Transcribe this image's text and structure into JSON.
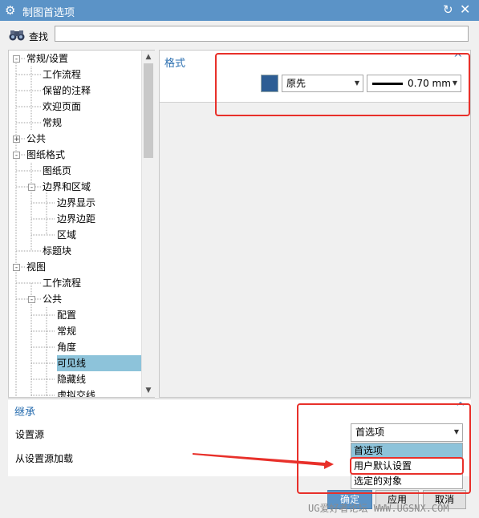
{
  "window": {
    "title": "制图首选项"
  },
  "find": {
    "label": "查找",
    "value": ""
  },
  "tree": {
    "items": [
      {
        "label": "常规/设置",
        "level": 0,
        "expander": "-"
      },
      {
        "label": "工作流程",
        "level": 1
      },
      {
        "label": "保留的注释",
        "level": 1
      },
      {
        "label": "欢迎页面",
        "level": 1
      },
      {
        "label": "常规",
        "level": 1
      },
      {
        "label": "公共",
        "level": 0,
        "expander": "+"
      },
      {
        "label": "图纸格式",
        "level": 0,
        "expander": "-"
      },
      {
        "label": "图纸页",
        "level": 1
      },
      {
        "label": "边界和区域",
        "level": 1,
        "expander": "-"
      },
      {
        "label": "边界显示",
        "level": 2
      },
      {
        "label": "边界边距",
        "level": 2
      },
      {
        "label": "区域",
        "level": 2
      },
      {
        "label": "标题块",
        "level": 1
      },
      {
        "label": "视图",
        "level": 0,
        "expander": "-"
      },
      {
        "label": "工作流程",
        "level": 1
      },
      {
        "label": "公共",
        "level": 1,
        "expander": "-"
      },
      {
        "label": "配置",
        "level": 2
      },
      {
        "label": "常规",
        "level": 2
      },
      {
        "label": "角度",
        "level": 2
      },
      {
        "label": "可见线",
        "level": 2,
        "selected": true
      },
      {
        "label": "隐藏线",
        "level": 2
      },
      {
        "label": "虚拟交线",
        "level": 2
      }
    ]
  },
  "format_section": {
    "title": "格式",
    "color": "#2d5d94",
    "color_name": "原先",
    "line_width": "0.70 mm"
  },
  "inherit_section": {
    "title": "继承",
    "source_label": "设置源",
    "load_label": "从设置源加载",
    "source_value": "首选项",
    "options": [
      "首选项",
      "用户默认设置",
      "选定的对象"
    ],
    "highlighted_option": "首选项"
  },
  "buttons": {
    "ok": "确定",
    "apply": "应用",
    "cancel": "取消"
  },
  "watermark": "UG爱好者论坛 WWW.UGSNX.COM",
  "colors": {
    "titlebar": "#5b93c7",
    "accent": "#2b6fb0",
    "selection": "#8dc3da",
    "annotation": "#e8302a"
  }
}
